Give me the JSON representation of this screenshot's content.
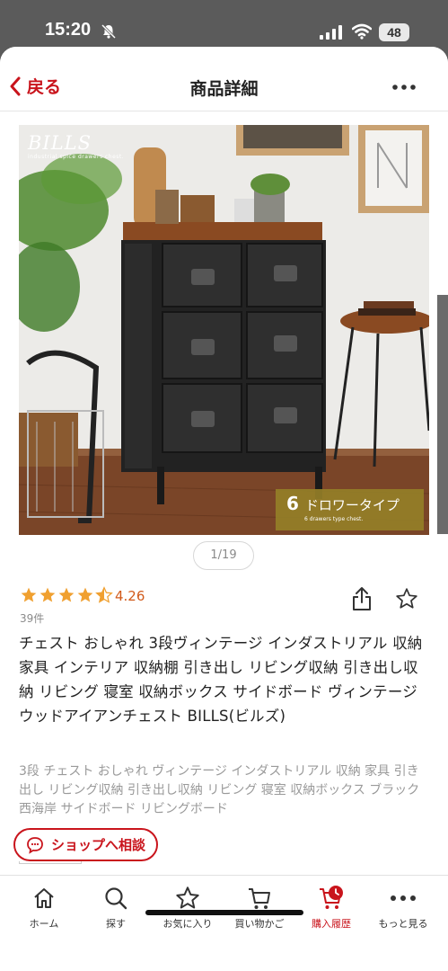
{
  "status_bar": {
    "time": "15:20",
    "battery": "48"
  },
  "header": {
    "back_label": "戻る",
    "title": "商品詳細"
  },
  "product_image": {
    "brand": "BILLS",
    "brand_sub": "industrial spice drawers chest.",
    "badge_number": "6",
    "badge_text": "ドロワータイプ",
    "badge_sub": "6 drawers type chest.",
    "pager": "1/19"
  },
  "rating": {
    "value": "4.26",
    "stars": 4.5,
    "count": "39件"
  },
  "product": {
    "title": "チェスト おしゃれ 3段ヴィンテージ インダストリアル 収納 家具 インテリア 収納棚 引き出し リビング収納 引き出し収納 リビング 寝室 収納ボックス サイドボード ヴィンテージウッドアイアンチェスト BILLS(ビルズ)",
    "description": "3段 チェスト おしゃれ ヴィンテージ インダストリアル 収納 家具 引き出し リビング収納 引き出し収納 リビング 寝室 収納ボックス ブラック 西海岸 サイドボード リビングボード"
  },
  "consult_button": "ショップへ相談",
  "tabs": [
    {
      "label": "ホーム",
      "icon": "home-icon"
    },
    {
      "label": "探す",
      "icon": "search-icon"
    },
    {
      "label": "お気に入り",
      "icon": "star-icon"
    },
    {
      "label": "買い物かご",
      "icon": "cart-icon"
    },
    {
      "label": "購入履歴",
      "icon": "purchase-history-icon",
      "active": true
    },
    {
      "label": "もっと見る",
      "icon": "more-icon"
    }
  ],
  "colors": {
    "accent": "#c9141c",
    "rating": "#f0a030",
    "badge": "#937e28"
  }
}
